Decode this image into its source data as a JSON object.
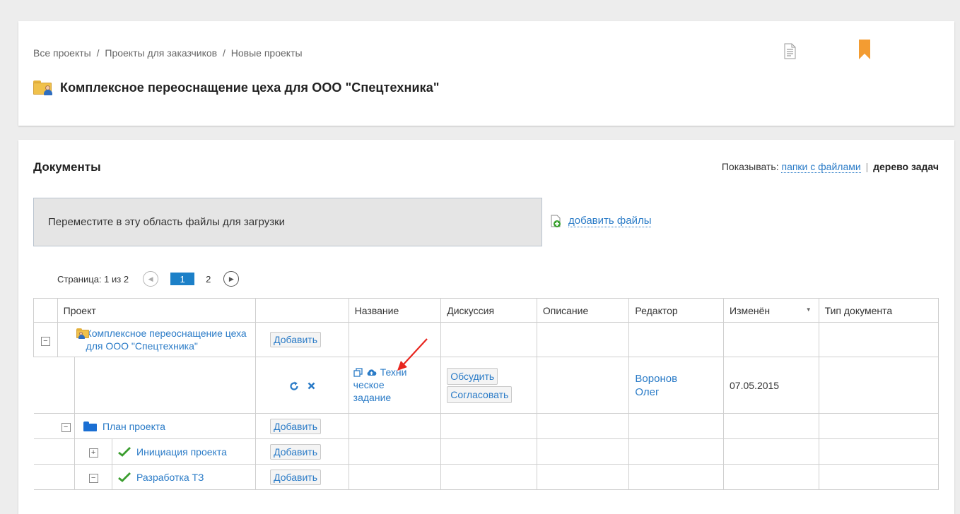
{
  "header": {
    "breadcrumb": [
      "Все проекты",
      "Проекты для заказчиков",
      "Новые проекты"
    ],
    "breadcrumb_separator": "/",
    "title": "Комплексное переоснащение цеха для ООО \"Спецтехника\"",
    "icons": {
      "folder": "folder-user-icon",
      "document": "document-icon",
      "bookmark": "bookmark-icon"
    }
  },
  "documents": {
    "title": "Документы",
    "show_label": "Показывать:",
    "show_option_folders": "папки с файлами",
    "show_separator": "|",
    "show_option_tree": "дерево задач",
    "dropzone_text": "Переместите в эту область файлы для загрузки",
    "add_files_label": "добавить файлы",
    "pager": {
      "label": "Страница: 1 из 2",
      "current_page": "1",
      "next_page": "2"
    },
    "table": {
      "columns": [
        "Проект",
        "",
        "Название",
        "Дискуссия",
        "Описание",
        "Редактор",
        "Изменён",
        "Тип документа"
      ],
      "sort_indicator": "▼",
      "rows": [
        {
          "project": "Комплексное переоснащение цеха для ООО \"Спецтехника\"",
          "action": "Добавить"
        },
        {
          "file_name": "Техническое задание",
          "file_name_lines": [
            "Техни",
            "ческое",
            "задание"
          ],
          "discuss_button": "Обсудить",
          "approve_button": "Согласовать",
          "editor_lines": [
            "Воронов",
            "Олег"
          ],
          "modified": "07.05.2015"
        },
        {
          "project": "План проекта",
          "action": "Добавить"
        },
        {
          "project": "Инициация проекта",
          "action": "Добавить"
        },
        {
          "project": "Разработка ТЗ",
          "action": "Добавить"
        }
      ]
    }
  },
  "colors": {
    "accent": "#2a7bc7",
    "page_current_bg": "#1c80c8",
    "bookmark": "#f39c32",
    "arrow": "#e8261f",
    "folder_blue": "#1a6fd3",
    "check": "#3a9d2e"
  }
}
